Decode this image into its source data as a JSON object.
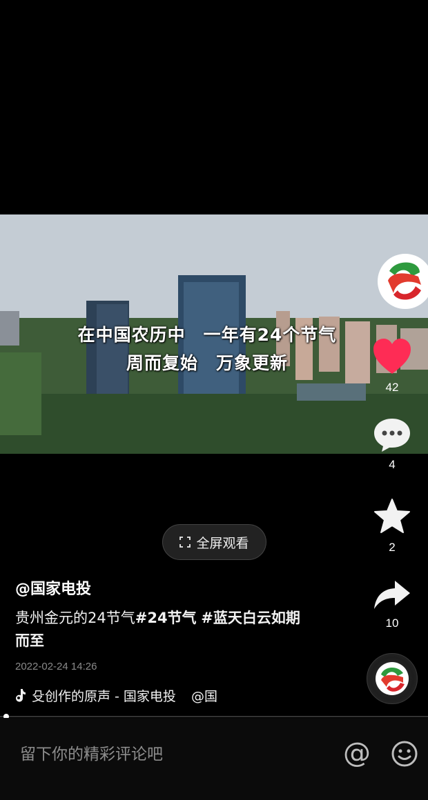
{
  "video": {
    "subtitle_line1": "在中国农历中　一年有24个节气",
    "subtitle_line2": "周而复始　万象更新"
  },
  "rail": {
    "likes": "42",
    "comments": "4",
    "favorites": "2",
    "shares": "10"
  },
  "fullscreen_label": "全屏观看",
  "post": {
    "author": "@国家电投",
    "caption_text": "贵州金元的24节气",
    "hashtag1": "#24节气",
    "hashtag2": "#蓝天白云如期而至",
    "date": "2022-02-24 14:26"
  },
  "music": {
    "label": "殳创作的原声 - 国家电投",
    "mention": "@国"
  },
  "comment": {
    "placeholder": "留下你的精彩评论吧"
  },
  "colors": {
    "like_red": "#fe2c55",
    "background": "#000000"
  },
  "progress": 0.01
}
